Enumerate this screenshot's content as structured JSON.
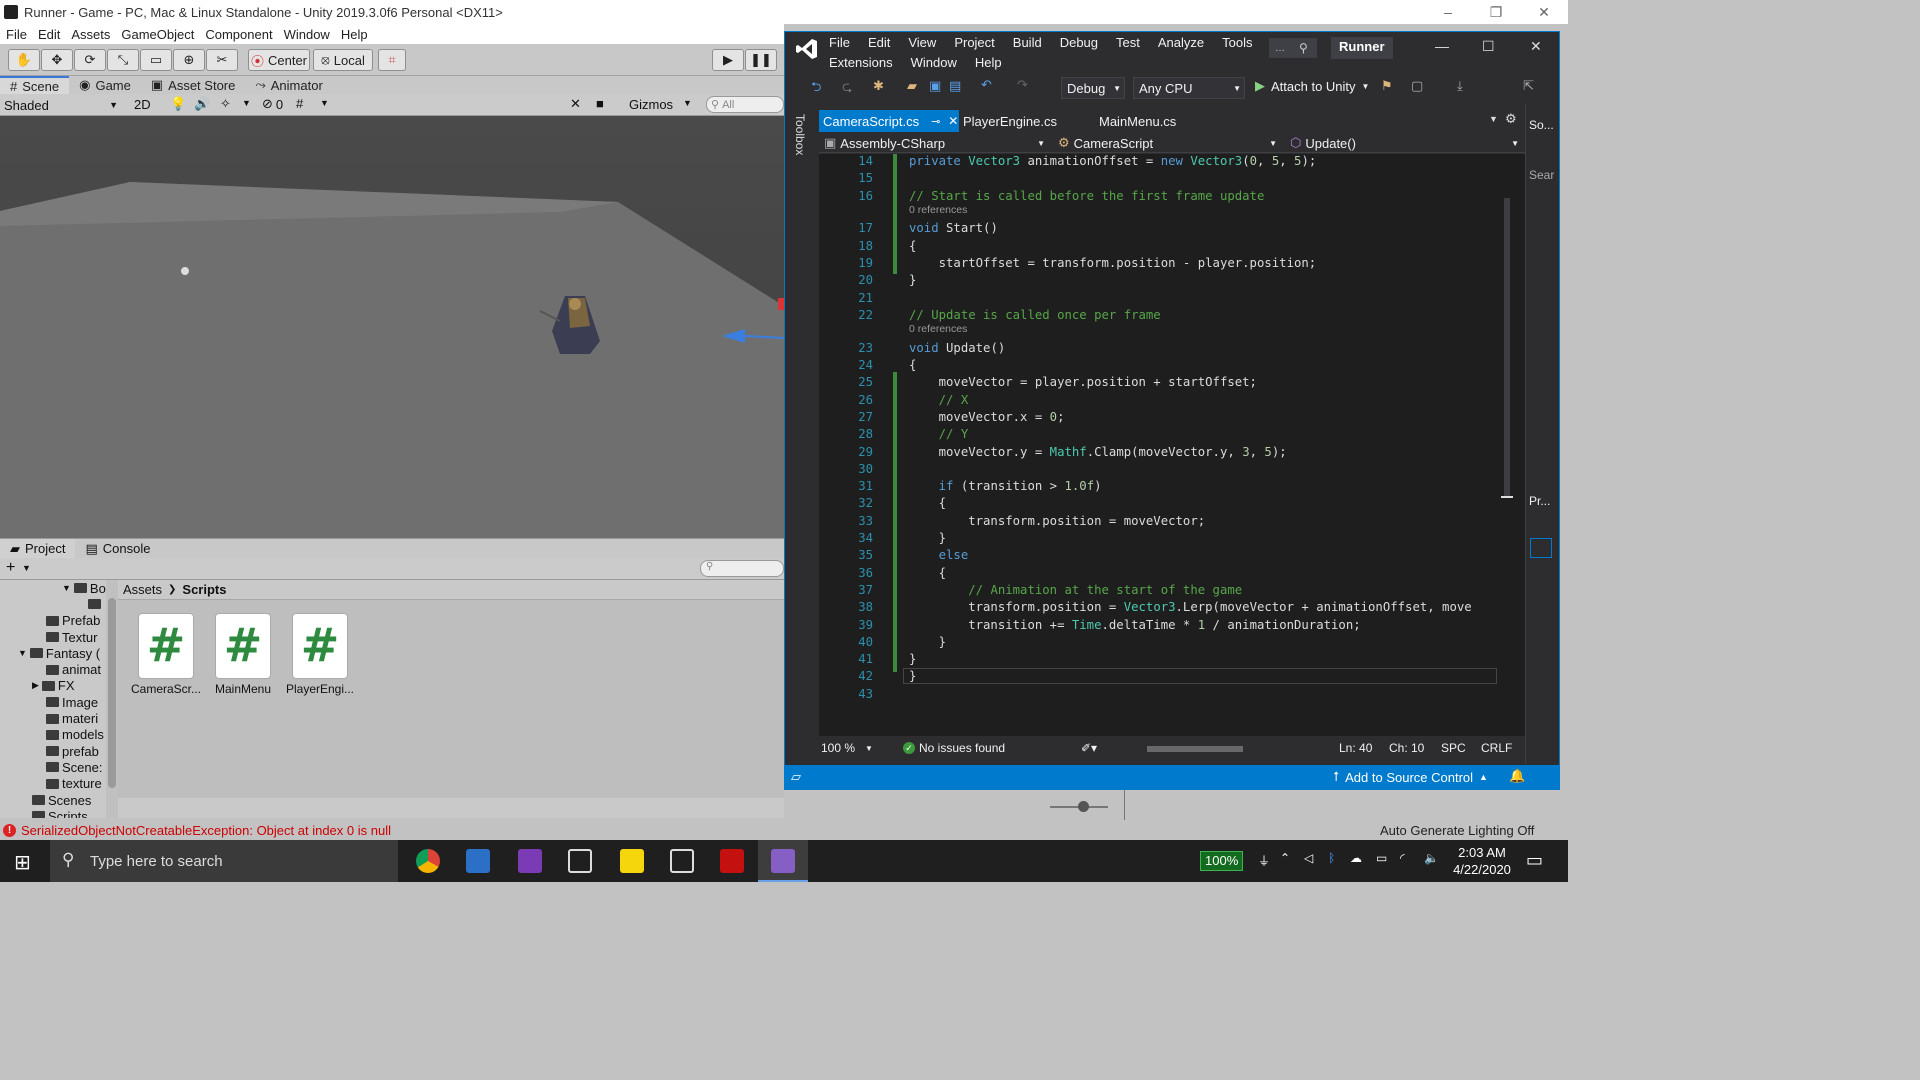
{
  "unity": {
    "title": "Runner - Game - PC, Mac & Linux Standalone - Unity 2019.3.0f6 Personal <DX11>",
    "menu": [
      "File",
      "Edit",
      "Assets",
      "GameObject",
      "Component",
      "Window",
      "Help"
    ],
    "toolbar": {
      "center": "Center",
      "local": "Local"
    },
    "scene_tabs": [
      "Scene",
      "Game",
      "Asset Store",
      "Animator"
    ],
    "scene_bar": {
      "shading": "Shaded",
      "mode2d": "2D",
      "hidden_count": "0",
      "gizmos": "Gizmos",
      "search_placeholder": "All"
    },
    "project_tabs": [
      "Project",
      "Console"
    ],
    "tree": [
      "Bo",
      "",
      "Prefab",
      "Textur",
      "Fantasy (",
      "animat",
      "FX",
      "Image",
      "materi",
      "models",
      "prefab",
      "Scene:",
      "texture",
      "Scenes",
      "Scripts"
    ],
    "breadcrumb": {
      "root": "Assets",
      "current": "Scripts"
    },
    "assets": [
      {
        "name": "CameraScr..."
      },
      {
        "name": "MainMenu"
      },
      {
        "name": "PlayerEngi..."
      }
    ],
    "status": {
      "error": "SerializedObjectNotCreatableException: Object at index 0 is null",
      "right": "Auto Generate Lighting Off"
    }
  },
  "vs": {
    "menu_row1": [
      "File",
      "Edit",
      "View",
      "Project",
      "Build",
      "Debug",
      "Test",
      "Analyze",
      "Tools"
    ],
    "menu_row2": [
      "Extensions",
      "Window",
      "Help"
    ],
    "solution": "Runner",
    "config": "Debug",
    "platform": "Any CPU",
    "attach": "Attach to Unity",
    "toolbox": "Toolbox",
    "tabs": [
      {
        "label": "CameraScript.cs",
        "active": true
      },
      {
        "label": "PlayerEngine.cs",
        "active": false
      },
      {
        "label": "MainMenu.cs",
        "active": false
      }
    ],
    "nav": {
      "project": "Assembly-CSharp",
      "class": "CameraScript",
      "member": "Update()"
    },
    "right_panel": [
      "So...",
      "Sear",
      "Pr..."
    ],
    "code_lines": [
      {
        "n": "14",
        "html": "    <span class='kw'>private</span> <span class='ty'>Vector3</span> animationOffset = <span class='kw'>new</span> <span class='ty'>Vector3</span>(<span class='nm'>0</span>, <span class='nm'>5</span>, <span class='nm'>5</span>);"
      },
      {
        "n": "15",
        "html": ""
      },
      {
        "n": "16",
        "html": "    <span class='cm'>// Start is called before the first frame update</span>"
      },
      {
        "ref": "0 references"
      },
      {
        "n": "17",
        "html": "    <span class='kw'>void</span> Start()"
      },
      {
        "n": "18",
        "html": "    {"
      },
      {
        "n": "19",
        "html": "        startOffset = transform.position - player.position;"
      },
      {
        "n": "20",
        "html": "    }"
      },
      {
        "n": "21",
        "html": ""
      },
      {
        "n": "22",
        "html": "    <span class='cm'>// Update is called once per frame</span>"
      },
      {
        "ref": "0 references"
      },
      {
        "n": "23",
        "html": "    <span class='kw'>void</span> Update()"
      },
      {
        "n": "24",
        "html": "    {"
      },
      {
        "n": "25",
        "html": "        moveVector = player.position + startOffset;"
      },
      {
        "n": "26",
        "html": "        <span class='cm'>// X</span>"
      },
      {
        "n": "27",
        "html": "        moveVector.x = <span class='nm'>0</span>;"
      },
      {
        "n": "28",
        "html": "        <span class='cm'>// Y</span>"
      },
      {
        "n": "29",
        "html": "        moveVector.y = <span class='ty'>Mathf</span>.Clamp(moveVector.y, <span class='nm'>3</span>, <span class='nm'>5</span>);"
      },
      {
        "n": "30",
        "html": ""
      },
      {
        "n": "31",
        "html": "        <span class='kw'>if</span> (transition > <span class='nm'>1.0f</span>)"
      },
      {
        "n": "32",
        "html": "        {"
      },
      {
        "n": "33",
        "html": "            transform.position = moveVector;"
      },
      {
        "n": "34",
        "html": "        }"
      },
      {
        "n": "35",
        "html": "        <span class='kw'>else</span>"
      },
      {
        "n": "36",
        "html": "        {"
      },
      {
        "n": "37",
        "html": "            <span class='cm'>// Animation at the start of the game</span>"
      },
      {
        "n": "38",
        "html": "            transform.position = <span class='ty'>Vector3</span>.Lerp(moveVector + animationOffset, move"
      },
      {
        "n": "39",
        "html": "            transition += <span class='ty'>Time</span>.deltaTime * <span class='nm'>1</span> / animationDuration;"
      },
      {
        "n": "40",
        "html": "        }"
      },
      {
        "n": "41",
        "html": "    }"
      },
      {
        "n": "42",
        "html": "}"
      },
      {
        "n": "43",
        "html": ""
      }
    ],
    "editor_status": {
      "zoom": "100 %",
      "issues": "No issues found",
      "ln": "Ln: 40",
      "ch": "Ch: 10",
      "spc": "SPC",
      "crlf": "CRLF"
    },
    "source_control": "Add to Source Control"
  },
  "taskbar": {
    "search_placeholder": "Type here to search",
    "battery": "100%",
    "time": "2:03 AM",
    "date": "4/22/2020"
  },
  "colors": {
    "vs_accent": "#007acc",
    "unity_bg": "#c2c2c2",
    "viewport": "#4c4c4c",
    "code_bg": "#1e1e1e"
  }
}
